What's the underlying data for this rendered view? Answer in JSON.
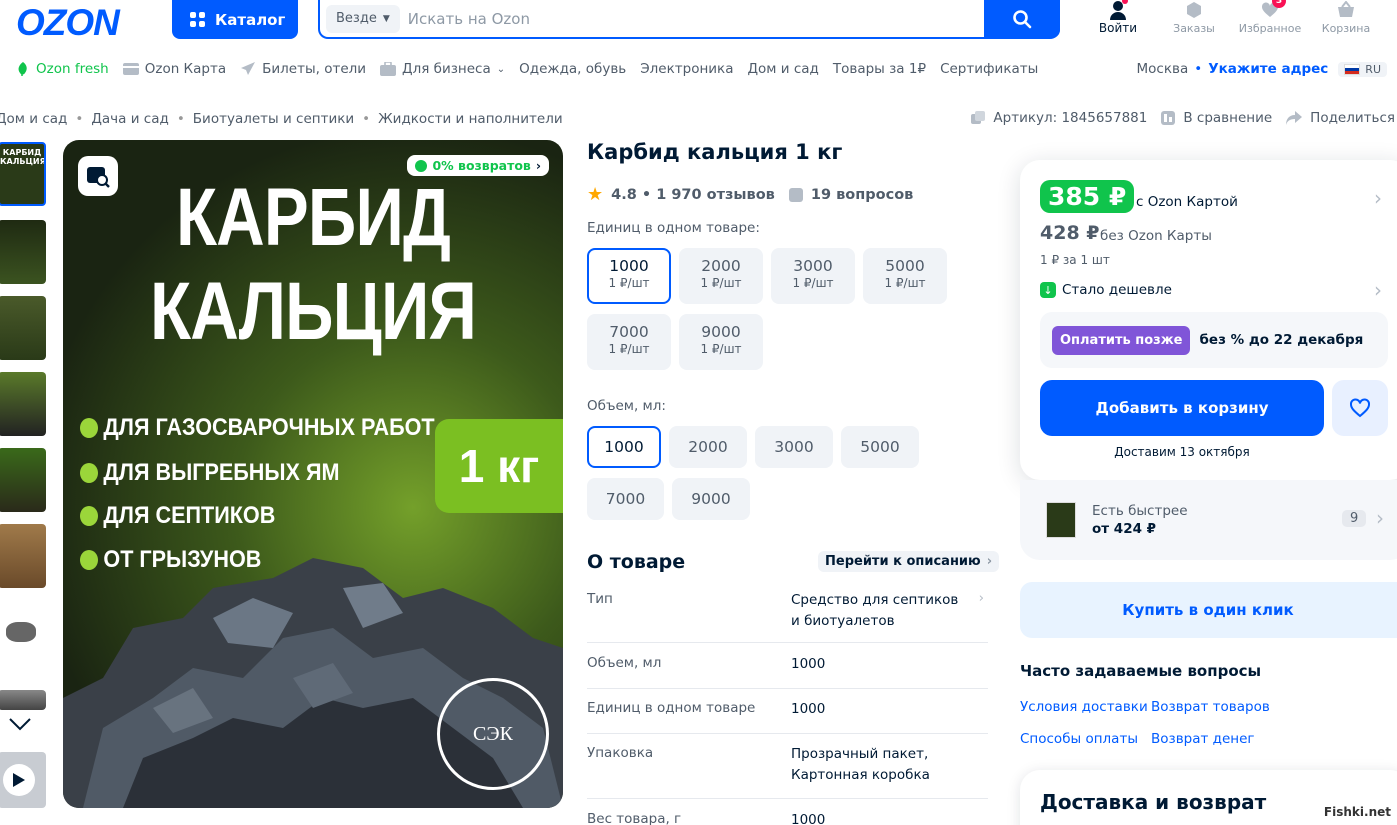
{
  "header": {
    "logo": "OZON",
    "catalog_label": "Каталог",
    "search_scope": "Везде",
    "search_placeholder": "Искать на Ozon",
    "actions": [
      {
        "label": "Войти"
      },
      {
        "label": "Заказы"
      },
      {
        "label": "Избранное",
        "badge": "3"
      },
      {
        "label": "Корзина"
      }
    ]
  },
  "nav": {
    "items": [
      "Ozon fresh",
      "Ozon Карта",
      "Билеты, отели",
      "Для бизнеса",
      "Одежда, обувь",
      "Электроника",
      "Дом и сад",
      "Товары за 1₽",
      "Сертификаты"
    ],
    "city": "Москва",
    "dot": "•",
    "address_link": "Укажите адрес",
    "lang": "RU"
  },
  "breadcrumbs": [
    "Дом и сад",
    "Дача и сад",
    "Биотуалеты и септики",
    "Жидкости и наполнители"
  ],
  "meta": {
    "sku": "Артикул: 1845657881",
    "compare": "В сравнение",
    "share": "Поделиться"
  },
  "hero": {
    "title_line1": "КАРБИД",
    "title_line2": "КАЛЬЦИЯ",
    "returns_badge": "0% возвратов",
    "bullets": [
      "ДЛЯ ГАЗОСВАРОЧНЫХ РАБОТ",
      "ДЛЯ ВЫГРЕБНЫХ ЯМ",
      "ДЛЯ СЕПТИКОВ",
      "ОТ ГРЫЗУНОВ"
    ],
    "weight_tag": "1 кг",
    "seal_text": "СЭК"
  },
  "product": {
    "title": "Карбид кальция 1 кг",
    "rating_text": "4.8 • 1 970 отзывов",
    "questions": "19 вопросов",
    "units_label": "Единиц в одном товаре:",
    "units": [
      {
        "value": "1000",
        "sub": "1 ₽/шт",
        "selected": true
      },
      {
        "value": "2000",
        "sub": "1 ₽/шт",
        "selected": false
      },
      {
        "value": "3000",
        "sub": "1 ₽/шт",
        "selected": false
      },
      {
        "value": "5000",
        "sub": "1 ₽/шт",
        "selected": false
      },
      {
        "value": "7000",
        "sub": "1 ₽/шт",
        "selected": false
      },
      {
        "value": "9000",
        "sub": "1 ₽/шт",
        "selected": false
      }
    ],
    "volume_label": "Объем, мл:",
    "volumes": [
      "1000",
      "2000",
      "3000",
      "5000",
      "7000",
      "9000"
    ],
    "about_title": "О товаре",
    "about_link": "Перейти к описанию",
    "specs": [
      {
        "k": "Тип",
        "v": "Средство для септиков и биотуалетов"
      },
      {
        "k": "Объем, мл",
        "v": "1000"
      },
      {
        "k": "Единиц в одном товаре",
        "v": "1000"
      },
      {
        "k": "Упаковка",
        "v": "Прозрачный пакет, Картонная коробка"
      },
      {
        "k": "Вес товара, г",
        "v": "1000"
      }
    ]
  },
  "buy": {
    "card_price": "385 ₽",
    "card_price_note": "с Ozon Картой",
    "price": "428 ₽",
    "price_note": "без Ozon Карты",
    "unit_price": "1 ₽ за 1 шт",
    "cheaper": "Стало дешевле",
    "pay_later": "Оплатить позже",
    "pay_later_note": "без % до 22 декабря",
    "add_to_cart": "Добавить в корзину",
    "delivery_date": "Доставим 13 октября",
    "faster_title": "Есть быстрее",
    "faster_price": "от 424 ₽",
    "faster_count": "9",
    "one_click": "Купить в один клик",
    "faq_title": "Часто задаваемые вопросы",
    "faq_links": [
      "Условия доставки",
      "Возврат товаров",
      "Способы оплаты",
      "Возврат денег"
    ],
    "delivery_title": "Доставка и возврат"
  },
  "watermark": "Fishki.net",
  "colors": {
    "brand": "#005bff",
    "green": "#10c44c",
    "pay_later": "#8055d8",
    "text": "#001a34"
  }
}
